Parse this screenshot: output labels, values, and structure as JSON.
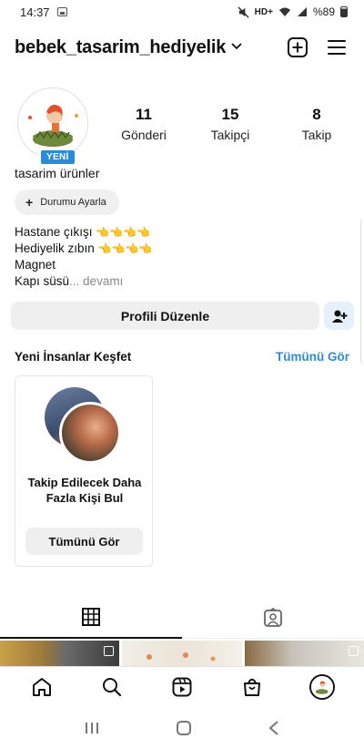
{
  "status_bar": {
    "time": "14:37",
    "network": "HD+",
    "battery": "%89"
  },
  "header": {
    "username": "bebek_tasarim_hediyelik"
  },
  "profile": {
    "badge": "YENİ",
    "stats": [
      {
        "value": "11",
        "label": "Gönderi"
      },
      {
        "value": "15",
        "label": "Takipçi"
      },
      {
        "value": "8",
        "label": "Takip"
      }
    ],
    "display_name": "tasarim ürünler",
    "status_button": "Durumu Ayarla",
    "bio": {
      "line1": "Hastane çıkışı",
      "line2": "Hediyelik zıbın",
      "line3": "Magnet",
      "line4": "Kapı süsü",
      "more": "... devamı"
    },
    "edit_button": "Profili Düzenle"
  },
  "discover": {
    "title": "Yeni İnsanlar Keşfet",
    "see_all": "Tümünü Gör",
    "card_text": "Takip Edilecek Daha Fazla Kişi Bul",
    "card_button": "Tümünü Gör"
  },
  "colors": {
    "accent": "#2b8bd8",
    "badge": "#2b8bd8"
  }
}
